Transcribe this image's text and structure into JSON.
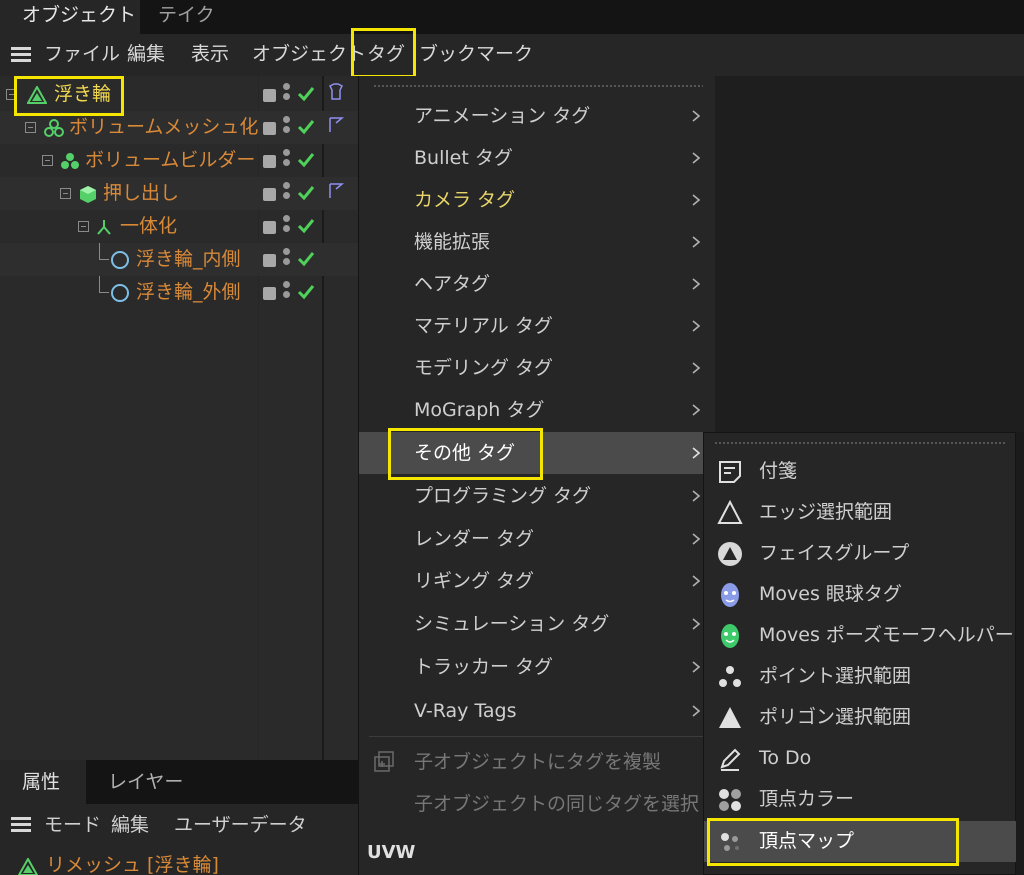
{
  "tabs": [
    {
      "label": "オブジェクト"
    },
    {
      "label": "テイク"
    }
  ],
  "menubar": [
    {
      "label": "ファイル"
    },
    {
      "label": "編集"
    },
    {
      "label": "表示"
    },
    {
      "label": "オブジェクト"
    },
    {
      "label": "タグ"
    },
    {
      "label": "ブックマーク"
    }
  ],
  "tree": [
    {
      "label": "浮き輪",
      "icon": "tri-icon"
    },
    {
      "label": "ボリュームメッシュ化",
      "icon": "mesh-icon"
    },
    {
      "label": "ボリュームビルダー",
      "icon": "builder-icon"
    },
    {
      "label": "押し出し",
      "icon": "extrude-icon"
    },
    {
      "label": "一体化",
      "icon": "connect-icon"
    },
    {
      "label": "浮き輪_内側",
      "icon": "circle-icon"
    },
    {
      "label": "浮き輪_外側",
      "icon": "circle-icon"
    }
  ],
  "attr": {
    "tabs": [
      {
        "label": "属性"
      },
      {
        "label": "レイヤー"
      }
    ],
    "menu": [
      {
        "label": "モード"
      },
      {
        "label": "編集"
      },
      {
        "label": "ユーザーデータ"
      }
    ],
    "object": "リメッシュ [浮き輪]"
  },
  "tag_menu": {
    "items": [
      {
        "label": "アニメーション タグ"
      },
      {
        "label": "Bullet タグ"
      },
      {
        "label": "カメラ タグ"
      },
      {
        "label": "機能拡張"
      },
      {
        "label": "ヘアタグ"
      },
      {
        "label": "マテリアル タグ"
      },
      {
        "label": "モデリング タグ"
      },
      {
        "label": "MoGraph タグ"
      },
      {
        "label": "その他 タグ"
      },
      {
        "label": "プログラミング タグ"
      },
      {
        "label": "レンダー タグ"
      },
      {
        "label": "リギング タグ"
      },
      {
        "label": "シミュレーション タグ"
      },
      {
        "label": "トラッカー タグ"
      },
      {
        "label": "V-Ray Tags"
      }
    ],
    "disabled": [
      {
        "label": "子オブジェクトにタグを複製"
      },
      {
        "label": "子オブジェクトの同じタグを選択"
      }
    ],
    "section": "UVW"
  },
  "submenu": {
    "items": [
      {
        "label": "付箋",
        "icon": "note-icon"
      },
      {
        "label": "エッジ選択範囲",
        "icon": "edge-selection-icon"
      },
      {
        "label": "フェイスグループ",
        "icon": "face-group-icon"
      },
      {
        "label": "Moves 眼球タグ",
        "icon": "moves-eye-icon"
      },
      {
        "label": "Moves ポーズモーフヘルパー",
        "icon": "moves-pose-icon"
      },
      {
        "label": "ポイント選択範囲",
        "icon": "point-selection-icon"
      },
      {
        "label": "ポリゴン選択範囲",
        "icon": "polygon-selection-icon"
      },
      {
        "label": "To Do",
        "icon": "todo-icon"
      },
      {
        "label": "頂点カラー",
        "icon": "vertex-color-icon"
      },
      {
        "label": "頂点マップ",
        "icon": "vertex-map-icon"
      }
    ]
  },
  "colors": {
    "highlight": "#f5e600",
    "object_text": "#d88938",
    "check": "#4fd15a",
    "menu_bg": "#262626",
    "selected_bg": "#4b4b4b"
  }
}
